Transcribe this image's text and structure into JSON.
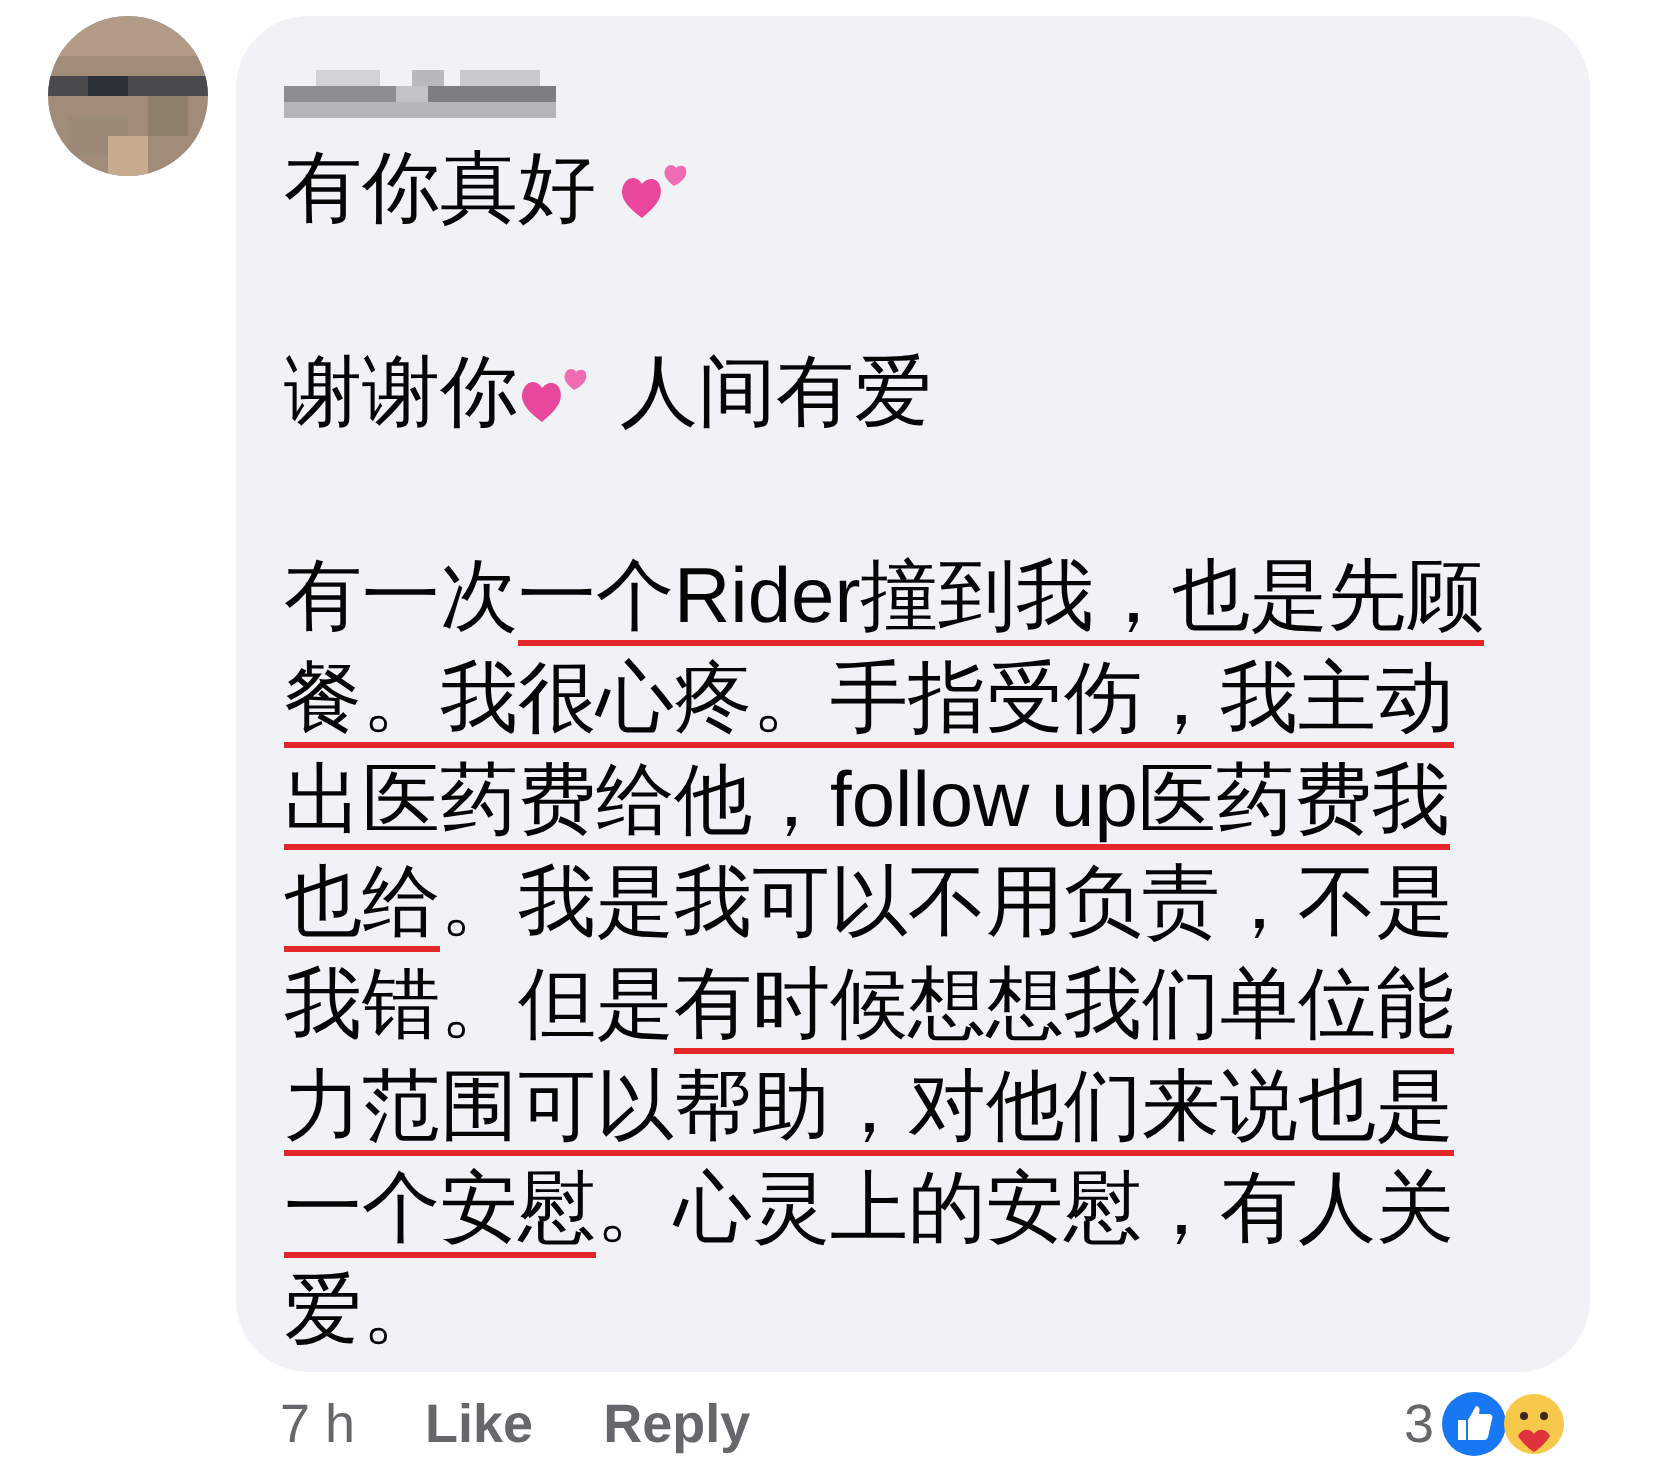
{
  "comment": {
    "paragraphs": [
      {
        "lines": [
          [
            {
              "kind": "text",
              "text": "有你真好 ",
              "underlined": false
            },
            {
              "kind": "emoji"
            }
          ]
        ]
      },
      {
        "lines": [
          [
            {
              "kind": "text",
              "text": "谢谢你",
              "underlined": false
            },
            {
              "kind": "emoji"
            },
            {
              "kind": "text",
              "text": " 人间有爱",
              "underlined": false
            }
          ]
        ]
      },
      {
        "lines": [
          [
            {
              "kind": "text",
              "text": "有一次",
              "underlined": false
            },
            {
              "kind": "text",
              "text": "一个Rider撞到我，也是先顾",
              "underlined": true
            }
          ],
          [
            {
              "kind": "text",
              "text": "餐。我很心疼。手指受伤，我主动",
              "underlined": true
            }
          ],
          [
            {
              "kind": "text",
              "text": "出医药费给他，follow up医药费我",
              "underlined": true
            }
          ],
          [
            {
              "kind": "text",
              "text": "也给",
              "underlined": true
            },
            {
              "kind": "text",
              "text": "。我是我可以不用负责，不是",
              "underlined": false
            }
          ],
          [
            {
              "kind": "text",
              "text": "我错。但是",
              "underlined": false
            },
            {
              "kind": "text",
              "text": "有时候想想我们单位能",
              "underlined": true
            }
          ],
          [
            {
              "kind": "text",
              "text": "力范围可以帮助，对他们来说也是",
              "underlined": true
            }
          ],
          [
            {
              "kind": "text",
              "text": "一个安慰",
              "underlined": true
            },
            {
              "kind": "text",
              "text": "。心灵上的安慰，有人关",
              "underlined": false
            }
          ],
          [
            {
              "kind": "text",
              "text": "爱。",
              "underlined": false
            }
          ]
        ]
      }
    ]
  },
  "footer": {
    "time": "7 h",
    "like": "Like",
    "reply": "Reply",
    "reaction_count": "3"
  }
}
